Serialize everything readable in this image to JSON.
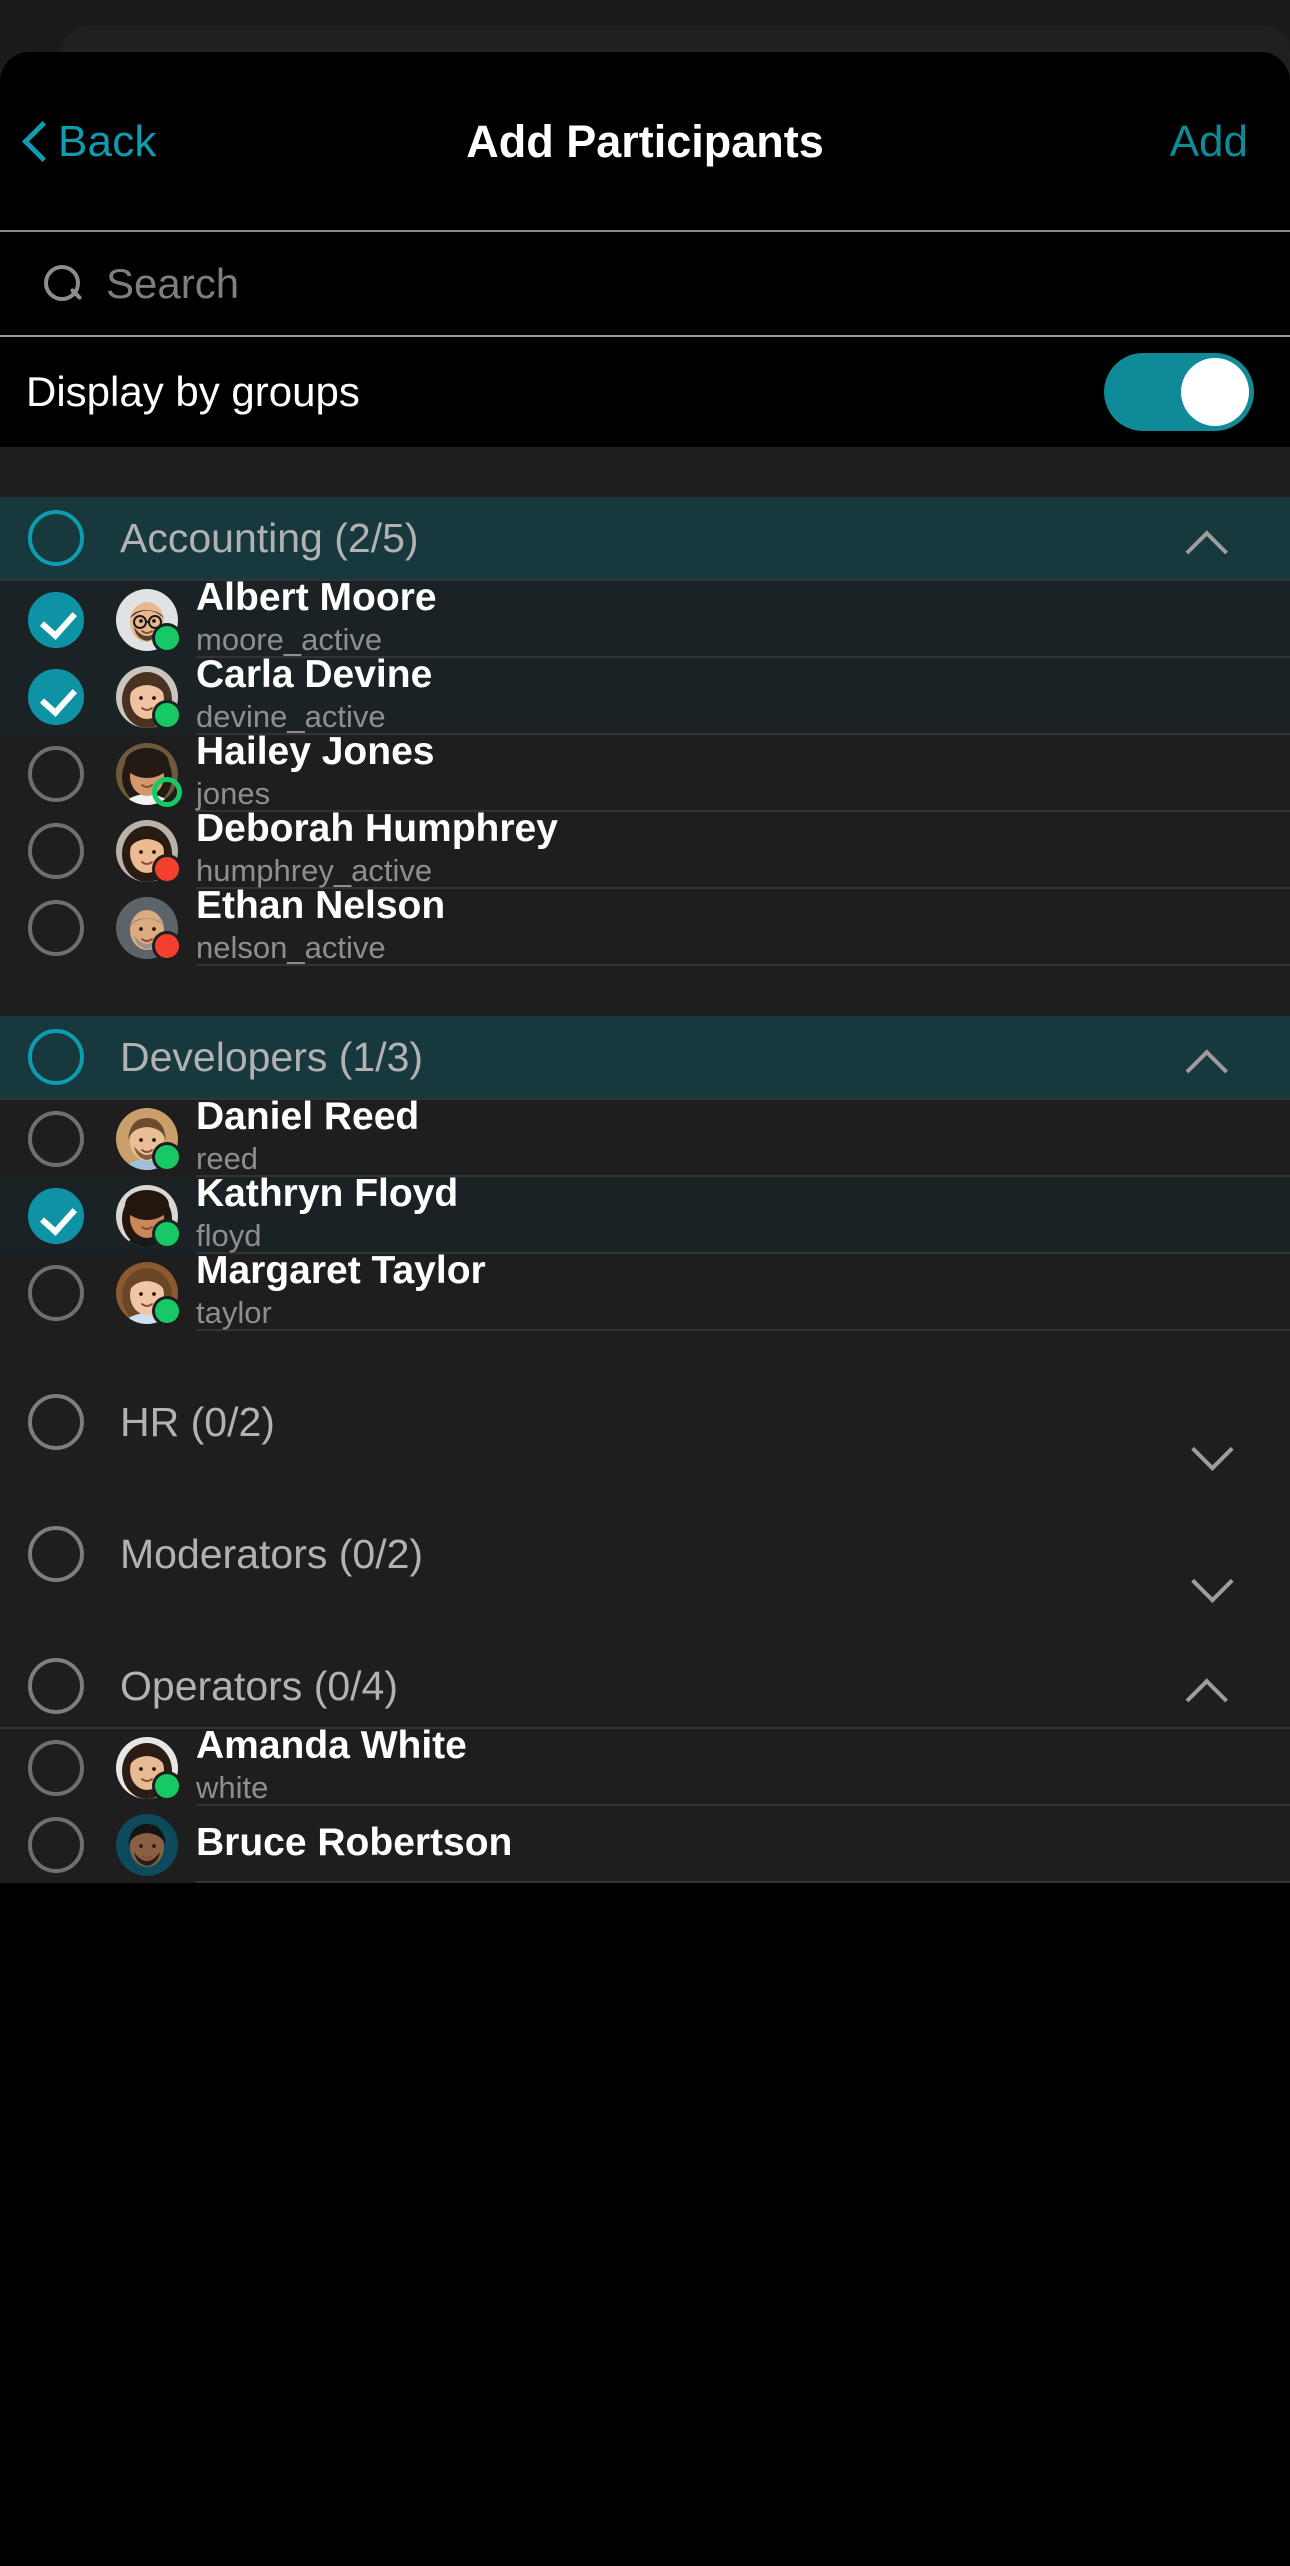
{
  "header": {
    "back_label": "Back",
    "back_icon": "chevron-left-icon",
    "title": "Add Participants",
    "add_label": "Add",
    "accent_color": "#0e9cb0"
  },
  "search": {
    "icon": "search-icon",
    "placeholder": "Search",
    "value": ""
  },
  "settings": {
    "display_by_groups_label": "Display by groups",
    "display_by_groups_on": true,
    "toggle_on_color": "#0e8a99"
  },
  "groups": [
    {
      "name": "Accounting",
      "count": "(2/5)",
      "expanded": true,
      "has_selection": true,
      "chevron": "chevron-up-icon",
      "members": [
        {
          "name": "Albert Moore",
          "handle": "moore_active",
          "selected": true,
          "status": "online",
          "avatar": "man-glasses-bald"
        },
        {
          "name": "Carla Devine",
          "handle": "devine_active",
          "selected": true,
          "status": "online",
          "avatar": "woman-brown-hair"
        },
        {
          "name": "Hailey Jones",
          "handle": "jones",
          "selected": false,
          "status": "away",
          "avatar": "woman-curly-white-top"
        },
        {
          "name": "Deborah Humphrey",
          "handle": "humphrey_active",
          "selected": false,
          "status": "busy",
          "avatar": "woman-dark-hair"
        },
        {
          "name": "Ethan Nelson",
          "handle": "nelson_active",
          "selected": false,
          "status": "busy",
          "avatar": "man-beard-grey"
        }
      ]
    },
    {
      "name": "Developers",
      "count": "(1/3)",
      "expanded": true,
      "has_selection": true,
      "chevron": "chevron-up-icon",
      "members": [
        {
          "name": "Daniel Reed",
          "handle": "reed",
          "selected": false,
          "status": "online",
          "avatar": "man-blue-shirt"
        },
        {
          "name": "Kathryn Floyd",
          "handle": "floyd",
          "selected": true,
          "status": "online",
          "avatar": "woman-curly-black-top"
        },
        {
          "name": "Margaret Taylor",
          "handle": "taylor",
          "selected": false,
          "status": "online",
          "avatar": "woman-blonde-stripes"
        }
      ]
    },
    {
      "name": "HR",
      "count": "(0/2)",
      "expanded": false,
      "has_selection": false,
      "chevron": "chevron-down-icon",
      "members": []
    },
    {
      "name": "Moderators",
      "count": "(0/2)",
      "expanded": false,
      "has_selection": false,
      "chevron": "chevron-down-icon",
      "members": []
    },
    {
      "name": "Operators",
      "count": "(0/4)",
      "expanded": true,
      "has_selection": false,
      "chevron": "chevron-up-icon",
      "members": [
        {
          "name": "Amanda White",
          "handle": "white",
          "selected": false,
          "status": "online",
          "avatar": "woman-long-dark-hair"
        },
        {
          "name": "Bruce Robertson",
          "handle": "",
          "selected": false,
          "status": "none",
          "avatar": "man-teal-bg"
        }
      ]
    }
  ],
  "status_colors": {
    "online": "#17c964",
    "away": "#17c964",
    "busy": "#f43f2e"
  }
}
